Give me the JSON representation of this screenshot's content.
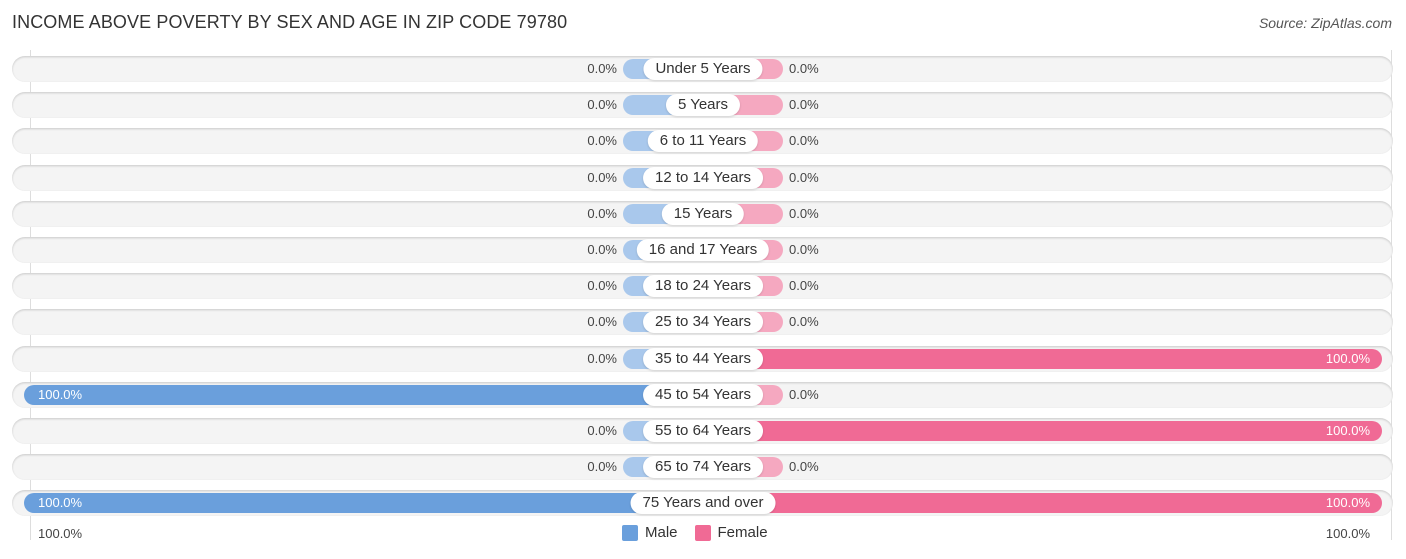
{
  "header": {
    "title": "INCOME ABOVE POVERTY BY SEX AND AGE IN ZIP CODE 79780",
    "source": "Source: ZipAtlas.com"
  },
  "colors": {
    "male_full": "#6a9fdc",
    "male_zero": "#a9c8ec",
    "female_full": "#f06a95",
    "female_zero": "#f5a8c0"
  },
  "chart_data": {
    "type": "bar",
    "orientation": "horizontal-diverging",
    "title": "INCOME ABOVE POVERTY BY SEX AND AGE IN ZIP CODE 79780",
    "categories": [
      "Under 5 Years",
      "5 Years",
      "6 to 11 Years",
      "12 to 14 Years",
      "15 Years",
      "16 and 17 Years",
      "18 to 24 Years",
      "25 to 34 Years",
      "35 to 44 Years",
      "45 to 54 Years",
      "55 to 64 Years",
      "65 to 74 Years",
      "75 Years and over"
    ],
    "series": [
      {
        "name": "Male",
        "values": [
          0,
          0,
          0,
          0,
          0,
          0,
          0,
          0,
          0,
          100,
          0,
          0,
          100
        ],
        "labels": [
          "0.0%",
          "0.0%",
          "0.0%",
          "0.0%",
          "0.0%",
          "0.0%",
          "0.0%",
          "0.0%",
          "0.0%",
          "100.0%",
          "0.0%",
          "0.0%",
          "100.0%"
        ]
      },
      {
        "name": "Female",
        "values": [
          0,
          0,
          0,
          0,
          0,
          0,
          0,
          0,
          100,
          0,
          100,
          0,
          100
        ],
        "labels": [
          "0.0%",
          "0.0%",
          "0.0%",
          "0.0%",
          "0.0%",
          "0.0%",
          "0.0%",
          "0.0%",
          "100.0%",
          "0.0%",
          "100.0%",
          "0.0%",
          "100.0%"
        ]
      }
    ],
    "xlim": [
      0,
      100
    ],
    "axis_labels": {
      "left": "100.0%",
      "right": "100.0%"
    },
    "legend": {
      "position": "bottom-center",
      "entries": [
        "Male",
        "Female"
      ]
    },
    "grid": false
  }
}
